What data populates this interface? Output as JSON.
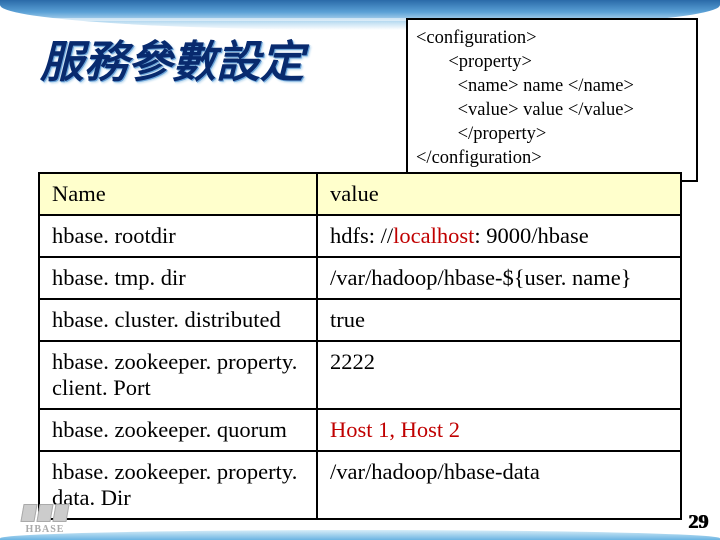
{
  "title": "服務參數設定",
  "xml": {
    "l1": "<configuration>",
    "l2": "       <property>",
    "l3": "         <name> name </name>",
    "l4": "         <value> value </value>",
    "l5": "         </property>",
    "l6": "</configuration>"
  },
  "table": {
    "header": {
      "name": "Name",
      "value": "value"
    },
    "rows": [
      {
        "name": "hbase. rootdir",
        "value_pre": "hdfs: //",
        "value_host": "localhost",
        "value_post": ": 9000/hbase"
      },
      {
        "name": "hbase. tmp. dir",
        "value_pre": "/var/hadoop/hbase-${user. name}",
        "value_host": "",
        "value_post": ""
      },
      {
        "name": "hbase. cluster. distributed",
        "value_pre": "true",
        "value_host": "",
        "value_post": ""
      },
      {
        "name": "hbase. zookeeper. property. client. Port",
        "value_pre": "2222",
        "value_host": "",
        "value_post": ""
      },
      {
        "name": "hbase. zookeeper. quorum",
        "value_pre": "",
        "value_host": "Host 1, Host 2",
        "value_post": ""
      },
      {
        "name": "hbase. zookeeper. property. data. Dir",
        "value_pre": "/var/hadoop/hbase-data",
        "value_host": "",
        "value_post": ""
      }
    ]
  },
  "logo_text": "HBASE",
  "page_number": "29"
}
